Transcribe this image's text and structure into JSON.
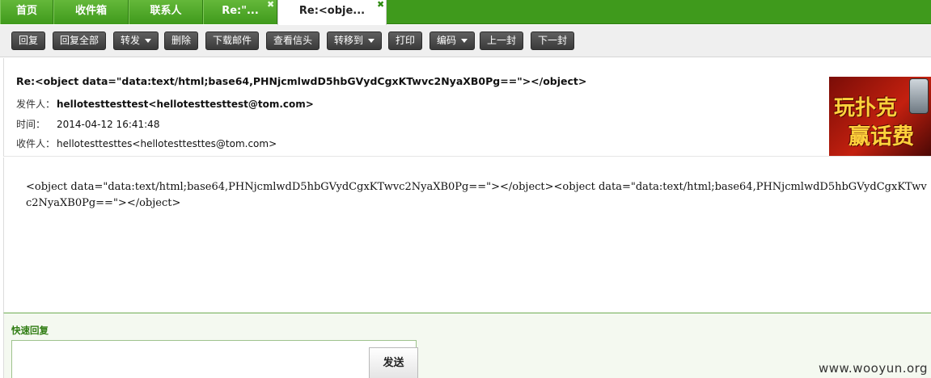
{
  "tabs": [
    {
      "label": "首页"
    },
    {
      "label": "收件箱"
    },
    {
      "label": "联系人"
    },
    {
      "label": "Re:\"..."
    },
    {
      "label": "Re:<obje..."
    }
  ],
  "tab_close_symbol": "✖",
  "toolbar": {
    "reply": "回复",
    "reply_all": "回复全部",
    "forward": "转发",
    "delete": "删除",
    "download": "下载邮件",
    "view_header": "查看信头",
    "move_to": "转移到",
    "print": "打印",
    "encoding": "编码",
    "prev": "上一封",
    "next": "下一封"
  },
  "mail": {
    "subject": "Re:<object data=\"data:text/html;base64,PHNjcmlwdD5hbGVydCgxKTwvc2NyaXB0Pg==\"></object>",
    "from_label": "发件人：",
    "from_value": "hellotesttesttest<hellotesttesttest@tom.com>",
    "time_label": "时间：",
    "time_value": "2014-04-12 16:41:48",
    "to_label": "收件人：",
    "to_value": "hellotesttesttes<hellotesttesttes@tom.com>",
    "body": "<object data=\"data:text/html;base64,PHNjcmlwdD5hbGVydCgxKTwvc2NyaXB0Pg==\"></object><object data=\"data:text/html;base64,PHNjcmlwdD5hbGVydCgxKTwvc2NyaXB0Pg==\"></object>"
  },
  "ad": {
    "line1": "玩扑克",
    "line2": "赢话费"
  },
  "quick_reply": {
    "title": "快速回复",
    "send": "发送"
  },
  "watermark": "www.wooyun.org",
  "colors": {
    "tab_green": "#3f9a1c",
    "button_dark": "#444444",
    "quick_reply_green": "#2f7d12"
  }
}
